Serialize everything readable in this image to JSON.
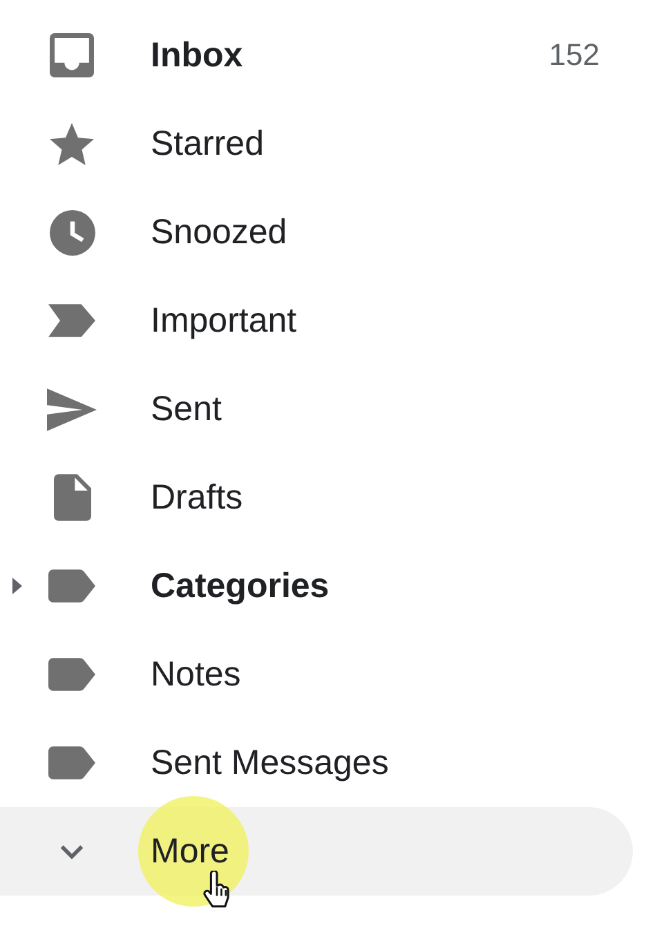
{
  "nav": {
    "items": [
      {
        "kind": "inbox",
        "label": "Inbox",
        "count": "152",
        "unread": true,
        "expandable": false
      },
      {
        "kind": "star",
        "label": "Starred",
        "unread": false,
        "expandable": false
      },
      {
        "kind": "clock",
        "label": "Snoozed",
        "unread": false,
        "expandable": false
      },
      {
        "kind": "important",
        "label": "Important",
        "unread": false,
        "expandable": false
      },
      {
        "kind": "sent",
        "label": "Sent",
        "unread": false,
        "expandable": false
      },
      {
        "kind": "draft",
        "label": "Drafts",
        "unread": false,
        "expandable": false
      },
      {
        "kind": "label",
        "label": "Categories",
        "unread": true,
        "expandable": true
      },
      {
        "kind": "label",
        "label": "Notes",
        "unread": false,
        "expandable": false
      },
      {
        "kind": "label",
        "label": "Sent Messages",
        "unread": false,
        "expandable": false
      }
    ]
  },
  "more": {
    "label": "More",
    "hovered": true
  }
}
